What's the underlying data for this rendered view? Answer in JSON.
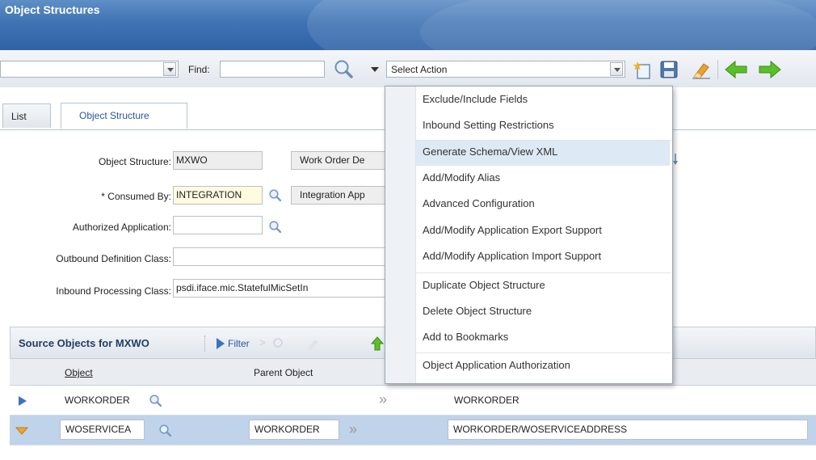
{
  "app": {
    "title": "Object Structures"
  },
  "toolbar": {
    "find_label": "Find:",
    "find_value": "",
    "select_action_value": "Select Action",
    "icons": [
      "search-icon",
      "dropdown-arrow-icon",
      "new-record-icon",
      "save-icon",
      "clear-changes-icon",
      "previous-record-icon",
      "next-record-icon"
    ]
  },
  "tabs": [
    {
      "label": "List"
    },
    {
      "label": "Object Structure"
    }
  ],
  "form": {
    "object_structure": {
      "label": "Object Structure:",
      "value": "MXWO",
      "description": "Work Order De"
    },
    "consumed_by": {
      "label": "* Consumed By:",
      "value": "INTEGRATION",
      "description": "Integration App"
    },
    "authorized_app": {
      "label": "Authorized Application:",
      "value": ""
    },
    "outbound_class": {
      "label": "Outbound Definition Class:",
      "value": ""
    },
    "inbound_class": {
      "label": "Inbound Processing Class:",
      "value": "psdi.iface.mic.StatefulMicSetIn"
    }
  },
  "source_table": {
    "title": "Source Objects for MXWO",
    "filter_label": "Filter",
    "columns": [
      "Object",
      "Parent Object"
    ],
    "rows": [
      {
        "object": "WORKORDER",
        "parent": "",
        "path": "WORKORDER"
      },
      {
        "object": "WOSERVICEA",
        "parent": "WORKORDER",
        "path": "WORKORDER/WOSERVICEADDRESS"
      }
    ]
  },
  "action_menu": {
    "items": [
      "Exclude/Include Fields",
      "Inbound Setting Restrictions",
      "Generate Schema/View XML",
      "Add/Modify Alias",
      "Advanced Configuration",
      "Add/Modify Application Export Support",
      "Add/Modify Application Import Support",
      "Duplicate Object Structure",
      "Delete Object Structure",
      "Add to Bookmarks",
      "Object Application Authorization"
    ],
    "highlighted": "Generate Schema/View XML"
  },
  "colors": {
    "title_blue": "#3f73b4",
    "selected_row": "#bfd3ea",
    "required_field": "#fffbe0"
  }
}
